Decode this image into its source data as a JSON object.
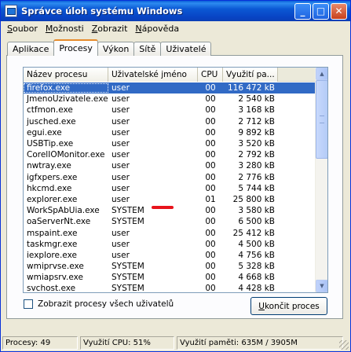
{
  "window": {
    "title": "Správce úloh systému Windows"
  },
  "menu": [
    {
      "key": "S",
      "rest": "oubor"
    },
    {
      "key": "M",
      "rest": "ožnosti"
    },
    {
      "key": "Z",
      "rest": "obrazit"
    },
    {
      "key": "N",
      "rest": "ápověda"
    }
  ],
  "tabs": [
    "Aplikace",
    "Procesy",
    "Výkon",
    "Sítě",
    "Uživatelé"
  ],
  "active_tab": "Procesy",
  "columns": {
    "name": "Název procesu",
    "user": "Uživatelské jméno",
    "cpu": "CPU",
    "mem": "Využití pa..."
  },
  "processes": [
    {
      "name": "firefox.exe",
      "user": "user",
      "cpu": "00",
      "mem": "116 472 kB"
    },
    {
      "name": "JmenoUzivatele.exe",
      "user": "user",
      "cpu": "00",
      "mem": "2 540 kB"
    },
    {
      "name": "ctfmon.exe",
      "user": "user",
      "cpu": "00",
      "mem": "3 168 kB"
    },
    {
      "name": "jusched.exe",
      "user": "user",
      "cpu": "00",
      "mem": "2 712 kB"
    },
    {
      "name": "egui.exe",
      "user": "user",
      "cpu": "00",
      "mem": "9 892 kB"
    },
    {
      "name": "USBTip.exe",
      "user": "user",
      "cpu": "00",
      "mem": "3 520 kB"
    },
    {
      "name": "CorelIOMonitor.exe",
      "user": "user",
      "cpu": "00",
      "mem": "2 792 kB"
    },
    {
      "name": "nwtray.exe",
      "user": "user",
      "cpu": "00",
      "mem": "3 280 kB"
    },
    {
      "name": "igfxpers.exe",
      "user": "user",
      "cpu": "00",
      "mem": "2 776 kB"
    },
    {
      "name": "hkcmd.exe",
      "user": "user",
      "cpu": "00",
      "mem": "5 744 kB"
    },
    {
      "name": "explorer.exe",
      "user": "user",
      "cpu": "01",
      "mem": "25 800 kB"
    },
    {
      "name": "WorkSpAbUia.exe",
      "user": "SYSTEM",
      "cpu": "00",
      "mem": "3 580 kB"
    },
    {
      "name": "oaServerNt.exe",
      "user": "SYSTEM",
      "cpu": "00",
      "mem": "6 500 kB"
    },
    {
      "name": "mspaint.exe",
      "user": "user",
      "cpu": "00",
      "mem": "25 412 kB"
    },
    {
      "name": "taskmgr.exe",
      "user": "user",
      "cpu": "00",
      "mem": "4 500 kB"
    },
    {
      "name": "iexplore.exe",
      "user": "user",
      "cpu": "00",
      "mem": "4 756 kB"
    },
    {
      "name": "wmiprvse.exe",
      "user": "SYSTEM",
      "cpu": "00",
      "mem": "5 328 kB"
    },
    {
      "name": "wmiapsrv.exe",
      "user": "SYSTEM",
      "cpu": "00",
      "mem": "4 668 kB"
    },
    {
      "name": "svchost.exe",
      "user": "SYSTEM",
      "cpu": "00",
      "mem": "4 428 kB"
    }
  ],
  "selected_process": "firefox.exe",
  "show_all_users": {
    "label": "Zobrazit procesy všech uživatelů",
    "checked": false
  },
  "end_process_button": {
    "key": "U",
    "rest": "končit proces"
  },
  "status": {
    "processes": "Procesy: 49",
    "cpu": "Využití CPU: 51%",
    "memory": "Využití paměti: 635M / 3905M"
  },
  "colors": {
    "selection": "#316ac5",
    "annotation": "#e8141c",
    "titlebar": "#0a5fd8"
  }
}
